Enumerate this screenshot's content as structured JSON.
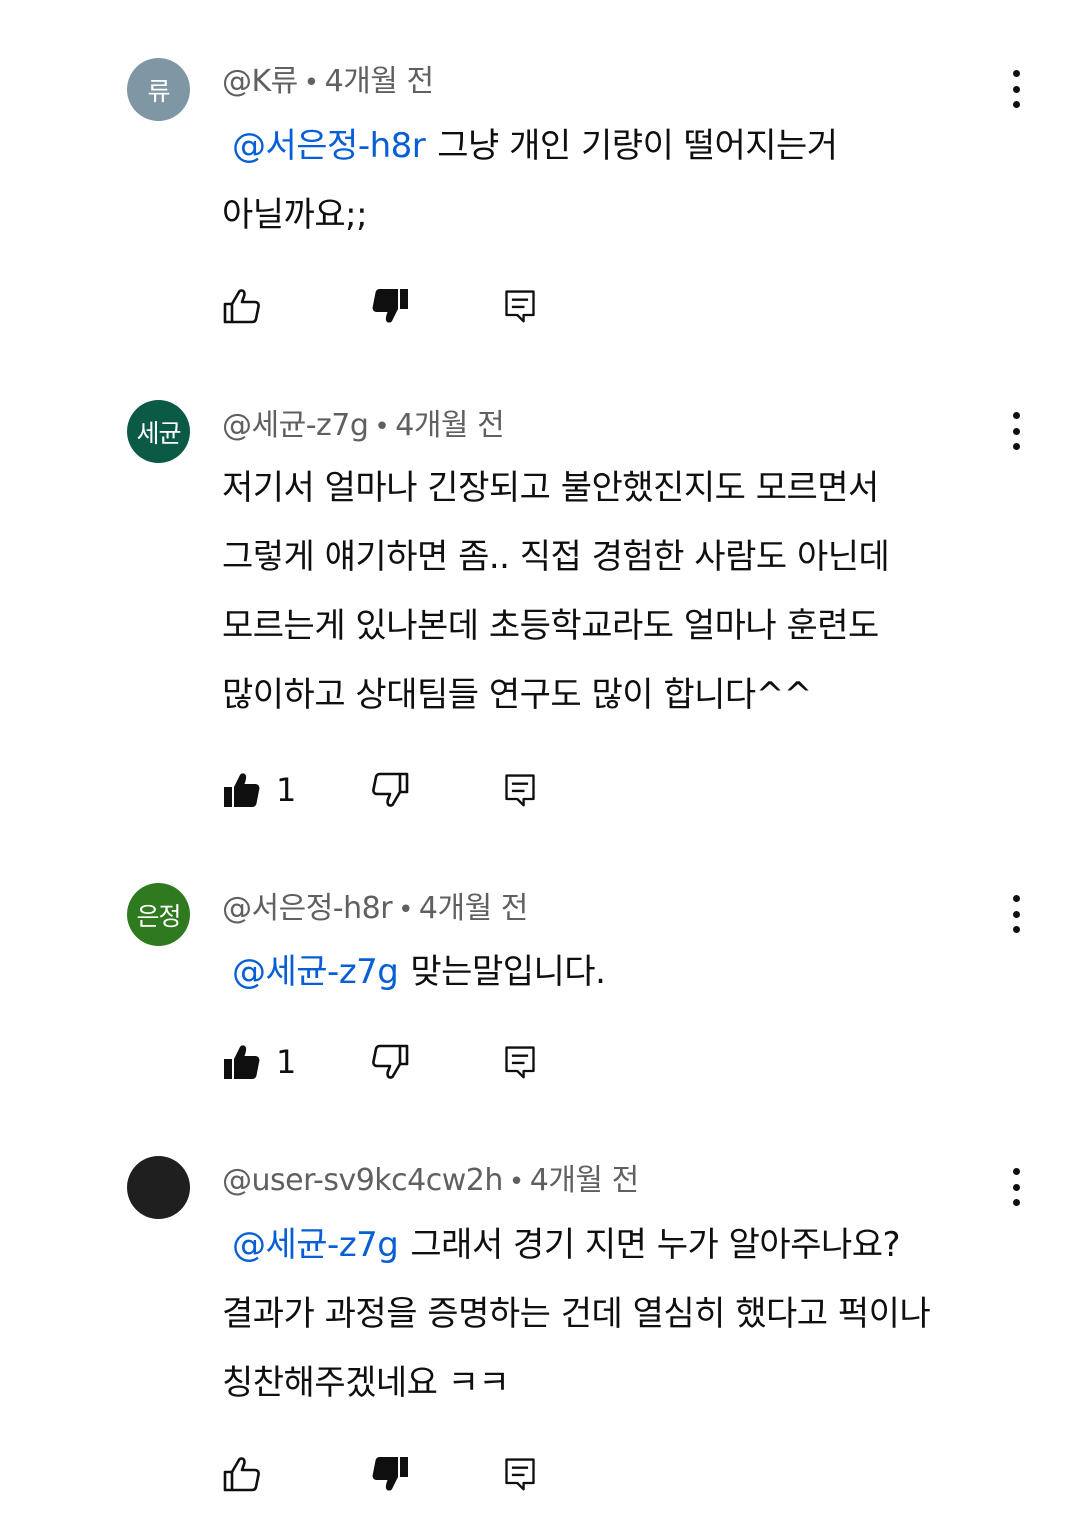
{
  "comments": [
    {
      "avatar_text": "류",
      "avatar_color": "#7f96a4",
      "author": "@K류",
      "separator": "•",
      "time": "4개월 전",
      "mention": "@서은정-h8r",
      "line1": "그냥 개인 기량이 떨어지는거",
      "line2": "아닐까요;;",
      "like_count": "",
      "liked": false,
      "disliked": true
    },
    {
      "avatar_text": "세균",
      "avatar_color": "#0a5a45",
      "author": "@세균-z7g",
      "separator": "•",
      "time": "4개월 전",
      "line1": "저기서 얼마나 긴장되고 불안했진지도 모르면서",
      "line2": "그렇게 얘기하면 좀.. 직접 경험한 사람도 아닌데",
      "line3": "모르는게 있나본데 초등학교라도 얼마나 훈련도",
      "line4": "많이하고 상대팀들 연구도 많이 합니다^^",
      "like_count": "1",
      "liked": true,
      "disliked": false
    },
    {
      "avatar_text": "은정",
      "avatar_color": "#2f7a1f",
      "author": "@서은정-h8r",
      "separator": "•",
      "time": "4개월 전",
      "mention": "@세균-z7g",
      "line1": "맞는말입니다.",
      "like_count": "1",
      "liked": true,
      "disliked": false
    },
    {
      "avatar_text": "",
      "avatar_color": "#1f1f1f",
      "author": "@user-sv9kc4cw2h",
      "separator": "•",
      "time": "4개월 전",
      "mention": "@세균-z7g",
      "line1": "그래서 경기 지면 누가 알아주나요?",
      "line2": "결과가 과정을 증명하는 건데 열심히 했다고 퍽이나",
      "line3": "칭찬해주겠네요 ㅋㅋ",
      "like_count": "",
      "liked": false,
      "disliked": true
    }
  ],
  "icons": {
    "like": "thumbs-up-icon",
    "dislike": "thumbs-down-icon",
    "reply": "reply-icon",
    "menu": "more-vertical-icon"
  }
}
